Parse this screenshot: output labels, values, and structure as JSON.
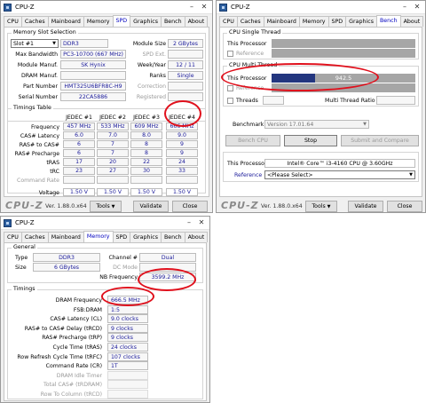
{
  "common": {
    "window_title": "CPU-Z",
    "logo_text": "CPU-Z",
    "version": "Ver. 1.88.0.x64",
    "tools": "Tools",
    "validate": "Validate",
    "close": "Close",
    "tabs": [
      "CPU",
      "Caches",
      "Mainboard",
      "Memory",
      "SPD",
      "Graphics",
      "Bench",
      "About"
    ]
  },
  "spd": {
    "slot_group": "Memory Slot Selection",
    "slot": "Slot #1",
    "type": "DDR3",
    "module_size_label": "Module Size",
    "module_size": "2 GBytes",
    "max_bw_label": "Max Bandwidth",
    "max_bw": "PC3-10700 (667 MHz)",
    "spd_ext_label": "SPD Ext.",
    "manuf_label": "Module Manuf.",
    "manuf": "SK Hynix",
    "week_label": "Week/Year",
    "week": "12 / 11",
    "dram_manuf_label": "DRAM Manuf.",
    "ranks_label": "Ranks",
    "ranks": "Single",
    "part_label": "Part Number",
    "part": "HMT325U6BFR8C-H9",
    "correction_label": "Correction",
    "serial_label": "Serial Number",
    "serial": "22CA5886",
    "registered_label": "Registered",
    "timings_group": "Timings Table",
    "headers": [
      "JEDEC #1",
      "JEDEC #2",
      "JEDEC #3",
      "JEDEC #4"
    ],
    "row_labels": [
      "Frequency",
      "CAS# Latency",
      "RAS# to CAS#",
      "RAS# Precharge",
      "tRAS",
      "tRC",
      "Command Rate",
      "Voltage"
    ],
    "cols": [
      [
        "457 MHz",
        "6.0",
        "6",
        "6",
        "17",
        "23",
        "",
        "1.50 V"
      ],
      [
        "533 MHz",
        "7.0",
        "7",
        "7",
        "20",
        "27",
        "",
        "1.50 V"
      ],
      [
        "609 MHz",
        "8.0",
        "8",
        "8",
        "22",
        "30",
        "",
        "1.50 V"
      ],
      [
        "666 MHz",
        "9.0",
        "9",
        "9",
        "24",
        "33",
        "",
        "1.50 V"
      ]
    ]
  },
  "bench": {
    "single_group": "CPU Single Thread",
    "this_processor": "This Processor",
    "reference": "Reference",
    "multi_group": "CPU Multi Thread",
    "multi_value": "942.5",
    "multi_fraction": 0.3,
    "threads_label": "Threads",
    "multi_ratio_label": "Multi Thread Ratio",
    "benchmark_label": "Benchmark",
    "benchmark_value": "Version 17.01.64",
    "bench_cpu": "Bench CPU",
    "stop": "Stop",
    "submit": "Submit and Compare",
    "cpu_label": "This Processor",
    "cpu_value": "Intel® Core™ i3-4160 CPU @ 3.60GHz",
    "ref_label": "Reference",
    "ref_value": "<Please Select>"
  },
  "memory": {
    "general_group": "General",
    "type_label": "Type",
    "type": "DDR3",
    "channel_label": "Channel #",
    "channel": "Dual",
    "size_label": "Size",
    "size": "6 GBytes",
    "dc_label": "DC Mode",
    "nb_label": "NB Frequency",
    "nb": "3599.2 MHz",
    "timings_group": "Timings",
    "rows": [
      {
        "label": "DRAM Frequency",
        "value": "666.5 MHz"
      },
      {
        "label": "FSB:DRAM",
        "value": "1:5"
      },
      {
        "label": "CAS# Latency (CL)",
        "value": "9.0 clocks"
      },
      {
        "label": "RAS# to CAS# Delay (tRCD)",
        "value": "9 clocks"
      },
      {
        "label": "RAS# Precharge (tRP)",
        "value": "9 clocks"
      },
      {
        "label": "Cycle Time (tRAS)",
        "value": "24 clocks"
      },
      {
        "label": "Row Refresh Cycle Time (tRFC)",
        "value": "107 clocks"
      },
      {
        "label": "Command Rate (CR)",
        "value": "1T"
      },
      {
        "label": "DRAM Idle Timer",
        "value": ""
      },
      {
        "label": "Total CAS# (tRDRAM)",
        "value": ""
      },
      {
        "label": "Row To Column (tRCD)",
        "value": ""
      }
    ]
  }
}
